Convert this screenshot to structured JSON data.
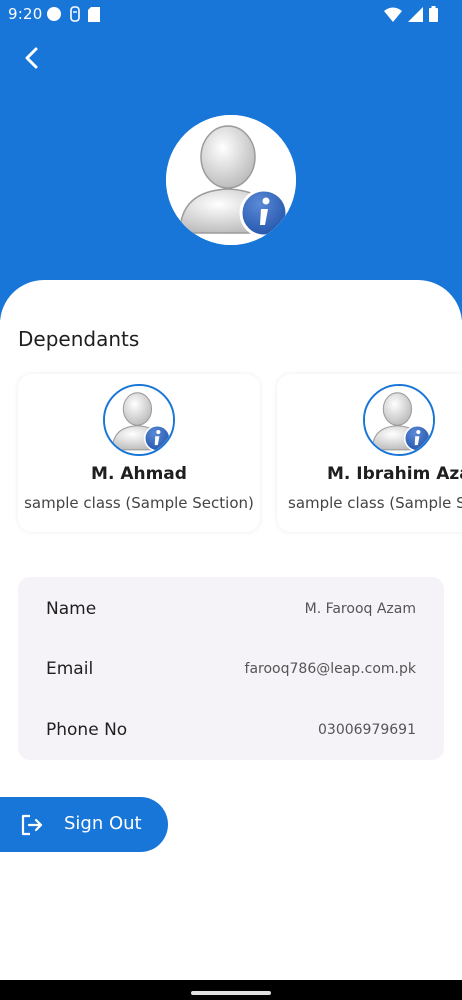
{
  "status_bar": {
    "time": "9:20",
    "icons_left": [
      "record-icon",
      "usb-icon",
      "sd-card-icon"
    ],
    "icons_right": [
      "wifi-icon",
      "signal-icon",
      "battery-icon"
    ]
  },
  "colors": {
    "primary": "#1976d9",
    "card_bg": "#f5f3f7",
    "text_dark": "#1f1f1f",
    "text_muted": "#555555"
  },
  "header": {
    "back_icon": "chevron-left-icon",
    "avatar_icon": "user-info-avatar-icon"
  },
  "dependants": {
    "title": "Dependants",
    "items": [
      {
        "name": "M. Ahmad",
        "class": "sample class (Sample Section)"
      },
      {
        "name": "M. Ibrahim Azam",
        "class": "sample class (Sample Section)"
      }
    ]
  },
  "info": {
    "rows": [
      {
        "label": "Name",
        "value": "M. Farooq Azam"
      },
      {
        "label": "Email",
        "value": "farooq786@leap.com.pk"
      },
      {
        "label": "Phone No",
        "value": "03006979691"
      }
    ]
  },
  "signout": {
    "label": "Sign Out",
    "icon": "logout-icon"
  }
}
